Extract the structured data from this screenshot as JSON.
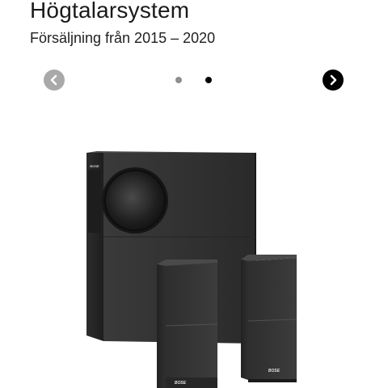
{
  "product": {
    "title": "Högtalarsystem",
    "subtitle": "Försäljning från 2015 – 2020"
  },
  "carousel": {
    "prev_icon": "chevron-left-icon",
    "next_icon": "chevron-right-icon",
    "dots_count": 2,
    "active_dot": 2,
    "prev_color": "#a9a9a9",
    "next_color": "#000000"
  },
  "image": {
    "brand_label": "BOSE"
  }
}
